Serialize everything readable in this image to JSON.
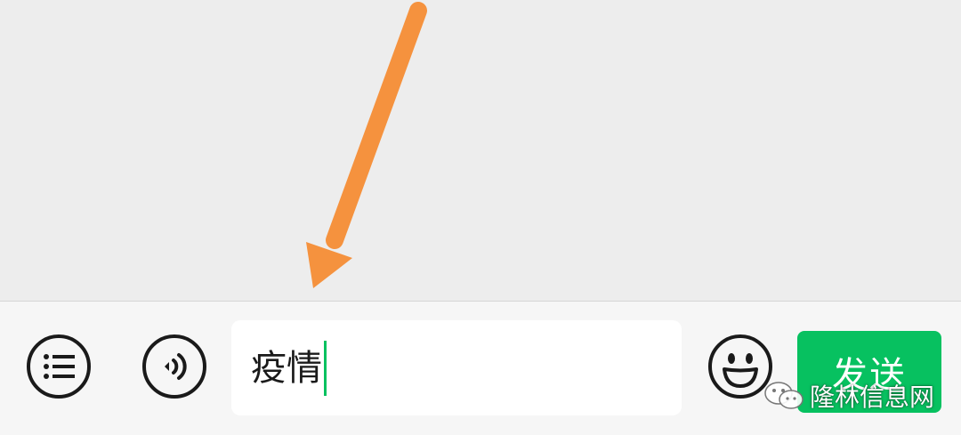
{
  "input_bar": {
    "menu_icon": "list-icon",
    "voice_icon": "voice-icon",
    "emoji_icon": "smiley-icon",
    "text_value": "疫情",
    "send_label": "发送"
  },
  "overlay": {
    "arrow_color": "#f5923e"
  },
  "watermark": {
    "icon": "wechat-icon",
    "text": "隆林信息网"
  },
  "colors": {
    "accent": "#07c160",
    "background": "#ededed",
    "bar": "#f6f6f6"
  }
}
